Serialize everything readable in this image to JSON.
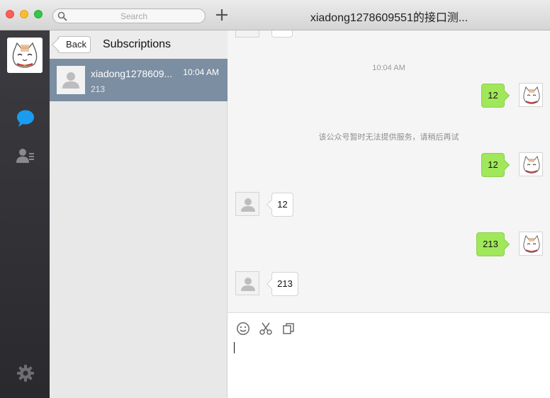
{
  "window": {
    "title": "xiadong1278609551的接口测..."
  },
  "search": {
    "placeholder": "Search"
  },
  "sidebar": {
    "nav": [
      {
        "name": "chats-icon"
      },
      {
        "name": "contacts-icon"
      },
      {
        "name": "settings-icon"
      }
    ]
  },
  "list": {
    "back_label": "Back",
    "title": "Subscriptions",
    "items": [
      {
        "name": "xiadong1278609...",
        "time": "10:04 AM",
        "preview": "213"
      }
    ]
  },
  "chat": {
    "timestamp": "10:04 AM",
    "system_note": "该公众号暂时无法提供服务，请稍后再试",
    "messages": [
      {
        "direction": "out",
        "text": "12"
      },
      {
        "direction": "out",
        "text": "12"
      },
      {
        "direction": "in",
        "text": "12"
      },
      {
        "direction": "out",
        "text": "213"
      },
      {
        "direction": "in",
        "text": "213"
      }
    ]
  },
  "composer": {
    "tools": [
      "emoji-icon",
      "scissors-icon",
      "copy-icon"
    ],
    "text": ""
  },
  "colors": {
    "outgoing_bubble": "#a0e75a",
    "selected_item": "#7b8ea2",
    "nav_bg": "#2f2f33"
  }
}
